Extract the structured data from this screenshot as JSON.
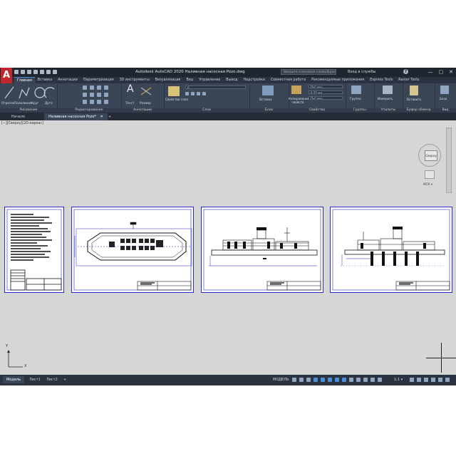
{
  "titlebar": {
    "app_title": "Autodesk AutoCAD 2020   Наливная насосная Pozo.dwg",
    "search_placeholder": "Введите ключевое слово/фразу",
    "signin": "Вход в службы",
    "help": "?",
    "window_buttons": [
      "—",
      "▢",
      "✕"
    ]
  },
  "ribbon_tabs": [
    "Главная",
    "Вставка",
    "Аннотации",
    "Параметризация",
    "3D инструменты",
    "Визуализация",
    "Вид",
    "Управление",
    "Вывод",
    "Надстройки",
    "Совместная работа",
    "Рекомендуемые приложения",
    "Express Tools",
    "Raster Tools"
  ],
  "ribbon_active_tab": "Главная",
  "ribbon": {
    "draw": {
      "title": "Рисование",
      "tools": [
        "Отрезок",
        "Полилиния",
        "Круг",
        "Дуга"
      ]
    },
    "modify": {
      "title": "Редактирование"
    },
    "annotation": {
      "title": "Аннотации",
      "tools": [
        "Текст",
        "Размер"
      ]
    },
    "layers": {
      "title": "Слои",
      "tool": "Свойства слоя",
      "current_layer": "0"
    },
    "block": {
      "title": "Блок",
      "tool": "Вставка"
    },
    "properties": {
      "title": "Свойства",
      "tool": "Копирование свойств",
      "color": "ПоСлою",
      "lineweight": "0,35 мм",
      "linetype": "ПоСлою"
    },
    "groups": {
      "title": "Группы",
      "tool": "Группа"
    },
    "utilities": {
      "title": "Утилиты",
      "tool": "Измерить"
    },
    "clipboard": {
      "title": "Буфер обмена",
      "tool": "Вставить"
    },
    "view": {
      "title": "Вид",
      "tool": "База"
    }
  },
  "file_tabs": [
    "Начало",
    "Наливная насосная Pozo*"
  ],
  "file_tab_close": "✕",
  "file_tab_add": "+",
  "canvas": {
    "view_label": "[−][Сверху][2D-каркас]",
    "viewcube_face": "Сверху",
    "viewcube_wcs": "МСК ▾",
    "ucs_x": "X",
    "ucs_y": "Y"
  },
  "statusbar": {
    "layout_tabs": [
      "Модель",
      "Лист1",
      "Лист2"
    ],
    "add_layout": "+",
    "model_label": "МОДЕЛЬ",
    "scale": "1:1 ▾"
  },
  "colors": {
    "app_bg": "#2b3340",
    "ribbon_bg": "#3a4556",
    "canvas_bg": "#d6d6d6",
    "frame_blue": "#2a2ac8",
    "autocad_red": "#c4262e"
  }
}
